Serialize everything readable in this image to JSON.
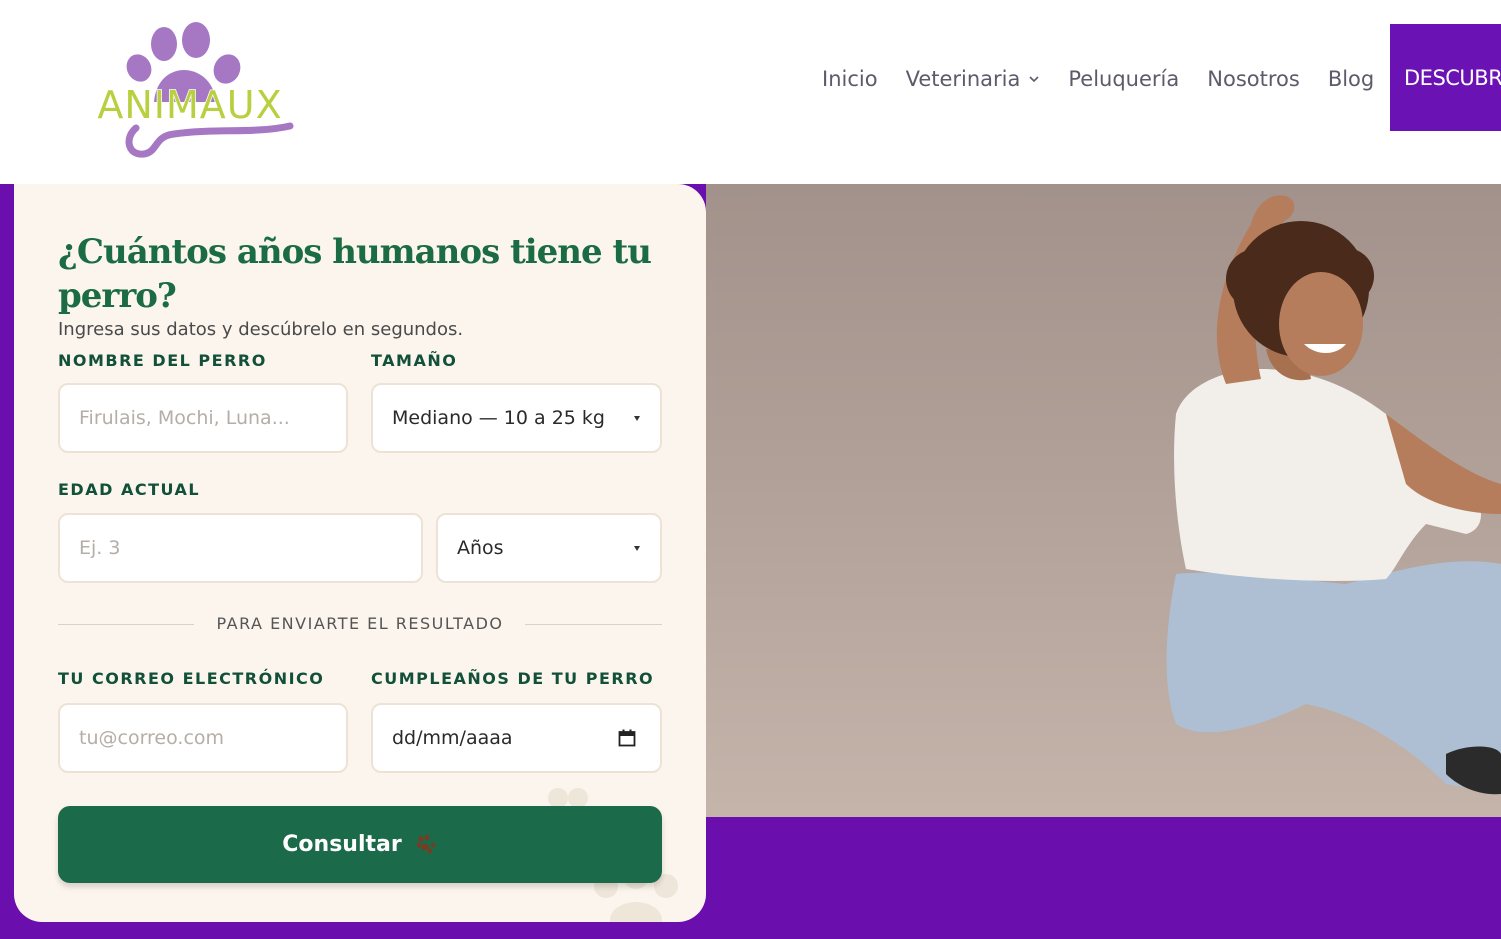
{
  "brand": {
    "logo_text": "ANIMAUX",
    "colors": {
      "paw": "#a678c4",
      "text": "#b8d040",
      "swirl": "#a678c4"
    }
  },
  "nav": {
    "items": [
      {
        "label": "Inicio",
        "has_dropdown": false
      },
      {
        "label": "Veterinaria",
        "has_dropdown": true
      },
      {
        "label": "Peluquería",
        "has_dropdown": false
      },
      {
        "label": "Nosotros",
        "has_dropdown": false
      },
      {
        "label": "Blog",
        "has_dropdown": false
      }
    ],
    "cta_label": "DESCUBR"
  },
  "form": {
    "title": "¿Cuántos años humanos tiene tu perro?",
    "subtitle": "Ingresa sus datos y descúbrelo en segundos.",
    "dog_name": {
      "label": "NOMBRE DEL PERRO",
      "placeholder": "Firulais, Mochi, Luna..."
    },
    "size": {
      "label": "TAMAÑO",
      "selected": "Mediano — 10 a 25 kg"
    },
    "age": {
      "label": "EDAD ACTUAL",
      "placeholder": "Ej. 3",
      "unit_selected": "Años"
    },
    "divider_text": "PARA ENVIARTE EL RESULTADO",
    "email": {
      "label": "TU CORREO ELECTRÓNICO",
      "placeholder": "tu@correo.com"
    },
    "birthday": {
      "label": "CUMPLEAÑOS DE TU PERRO",
      "placeholder": "dd/mm/aaaa",
      "icon": "calendar-icon"
    },
    "submit_label": "Consultar",
    "submit_icon": "paw-icon"
  },
  "colors": {
    "purple": "#6a0fae",
    "green": "#1b6b45",
    "card": "#fbf5ed"
  }
}
